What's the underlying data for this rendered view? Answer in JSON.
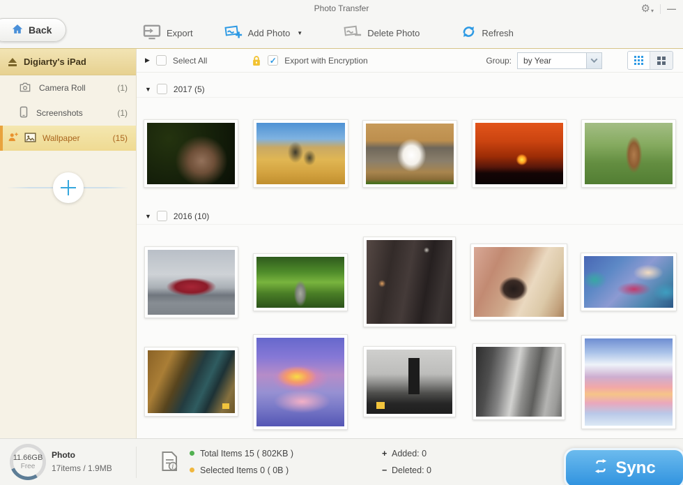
{
  "titlebar": {
    "title": "Photo Transfer"
  },
  "icons": {
    "gear": "⚙",
    "caret_down": "▾",
    "minimize": "—",
    "tri_right": "▶",
    "tri_down": "▼",
    "check": "✓"
  },
  "toolbar": {
    "back_label": "Back",
    "export_label": "Export",
    "add_photo_label": "Add Photo",
    "delete_photo_label": "Delete Photo",
    "refresh_label": "Refresh"
  },
  "sidebar": {
    "device_name": "Digiarty's iPad",
    "items": [
      {
        "label": "Camera Roll",
        "count": "(1)"
      },
      {
        "label": "Screenshots",
        "count": "(1)"
      },
      {
        "label": "Wallpaper",
        "count": "(15)"
      }
    ]
  },
  "filterbar": {
    "select_all": "Select All",
    "encryption": "Export with Encryption",
    "group_label": "Group:",
    "group_value": "by Year"
  },
  "groups": [
    {
      "title": "2017 (5)",
      "photos": [
        {
          "name": "squirrel-shouting",
          "style": "width:126px;height:88px;background:radial-gradient(ellipse 52px 50px at 62% 62%,#93715a 0%,#6e4f38 35%,rgba(20,26,12,0) 72%),radial-gradient(circle at 25% 25%,#24330f 0%,#15200a 55%,#0a0f06 100%)"
        },
        {
          "name": "zebras-in-grass",
          "style": "width:127px;height:88px;background:radial-gradient(ellipse 16px 22px at 44% 48%,#3e3a2c 0%,rgba(62,58,44,0) 70%),radial-gradient(ellipse 13px 16px at 60% 57%,#4a452f 0%,rgba(74,69,47,0) 70%),linear-gradient(180deg,#4e92d4 0%,#7fb2e0 26%,#c9a964 40%,#e0b653 60%,#d3a23f 82%,#c08f2f 100%)"
        },
        {
          "name": "white-cat-shelf",
          "style": "width:126px;height:87px;background:radial-gradient(ellipse 30px 34px at 52% 52%,#ffffff 0%,#f4f1ea 40%,rgba(244,241,234,0) 70%),linear-gradient(180deg,#c79a5a 0%,#bd8f4e 28%,#6f675a 40%,#8a7f6c 62%,#a8854e 80%,#8a6c38 92%,#49701f 98%)"
        },
        {
          "name": "sunset-windmill",
          "style": "width:126px;height:88px;background:radial-gradient(circle 11px at 53% 60%,#ffe94a 0%,#ff9a20 45%,rgba(255,154,32,0) 75%),linear-gradient(180deg,#e2541a 0%,#cb4410 30%,#9c2c06 55%,#58170a 72%,#140505 82%,#0b0304 100%)"
        },
        {
          "name": "squirrel-telescope",
          "style": "width:126px;height:88px;background:radial-gradient(ellipse 15px 34px at 56% 52%,#b07b4c 0%,#8f5e33 50%,rgba(143,94,51,0) 78%),linear-gradient(180deg,#a3bd85 0%,#86ab60 35%,#648e41 65%,#527e33 100%)"
        }
      ]
    },
    {
      "title": "2016 (10)",
      "photos": [
        {
          "name": "red-convertible-car",
          "style": "width:125px;height:93px;background:radial-gradient(ellipse 46px 17px at 50% 57%,#a82536 0%,#8c1b29 50%,rgba(140,27,41,0) 78%),linear-gradient(180deg,#b9bfc7 0%,#ced2d6 38%,#aab0b6 58%,#70767e 70%,#878d93 82%,#7e848a 100%)"
        },
        {
          "name": "green-tree-tunnel",
          "style": "width:126px;height:73px;background:radial-gradient(ellipse 13px 26px at 50% 72%,#a8aca0 0%,#7c8278 45%,rgba(124,130,120,0) 72%),linear-gradient(180deg,#2e5a1d 0%,#4f8c2a 30%,#79b43e 50%,#4a7e26 72%,#2c531a 100%)"
        },
        {
          "name": "dark-brick-street",
          "style": "width:123px;height:120px;background:radial-gradient(circle 7px at 18% 52%,#e0a060 0%,rgba(224,160,96,0) 75%),radial-gradient(circle 6px at 70% 12%,#c8c4bc 0%,rgba(200,196,188,0) 70%),linear-gradient(100deg,#554844 0%,#332b29 28%,#453b39 48%,#262020 68%,#3b3433 85%,#2d2726 100%)"
        },
        {
          "name": "old-piano-room",
          "style": "width:129px;height:100px;background:radial-gradient(ellipse 28px 24px at 44% 60%,#241c1a 0%,#3c2c26 50%,rgba(60,44,38,0) 74%),linear-gradient(115deg,#d8a896 0%,#c28a72 25%,#cfa98c 48%,#ead9c0 62%,#dcc9a8 78%,#c2a17c 92%,#a8835c 100%)"
        },
        {
          "name": "rain-window-bokeh",
          "style": "width:128px;height:74px;background:radial-gradient(ellipse 30px 16px at 72% 32%,#f2dcc2 0%,rgba(242,220,194,0) 72%),radial-gradient(ellipse 34px 14px at 56% 64%,#c33a6c 0%,rgba(195,58,108,0) 72%),radial-gradient(ellipse 24px 18px at 12% 46%,#38a8a4 0%,rgba(56,168,164,0) 72%),radial-gradient(ellipse 26px 18px at 92% 70%,#3e9ec0 0%,rgba(62,158,192,0) 72%),linear-gradient(135deg,#4866b4 0%,#5d89c6 30%,#8c9ad2 52%,#4a86ae 78%,#2c5886 100%)"
        },
        {
          "name": "canyon-river-aerial",
          "style": "width:125px;height:90px;background:linear-gradient(#f2c43c,#f2c43c) 93% 93%/10px 8px no-repeat,linear-gradient(115deg,#8a6226 0%,#aa7e36 22%,#57441e 38%,#233c40 52%,#2f5c60 64%,#1d3236 74%,#86713f 88%,#6b5527 100%)"
        },
        {
          "name": "watercolor-sunset-painting",
          "style": "width:126px;height:127px;background:radial-gradient(ellipse 38px 20px at 46% 44%,#f8dc44 0%,#f59a6a 40%,rgba(245,154,106,0) 75%),radial-gradient(ellipse 52px 26px at 50% 46%,#ef7fa6 0%,rgba(239,127,166,0) 78%),radial-gradient(ellipse 54px 22px at 52% 72%,#f3b0c6 0%,rgba(243,176,198,0) 75%),linear-gradient(180deg,#6668cc 0%,#8678d6 22%,#b68cc8 42%,#9690d2 62%,#7a7ac8 78%,#5456b4 100%)"
        },
        {
          "name": "bw-city-monolith",
          "style": "width:123px;height:92px;background:linear-gradient(#1c1c1c,#1c1c1c) 56% 30%/16px 52px no-repeat,linear-gradient(#f2c43c,#f2c43c) 12% 92%/12px 10px no-repeat,linear-gradient(180deg,#cfcfcd 0%,#bdbdbb 38%,#8d8d8b 52%,#4e4e4c 68%,#262626 84%,#1e1e1e 100%)"
        },
        {
          "name": "bw-arched-street",
          "style": "width:123px;height:100px;background:linear-gradient(100deg,#2e2e2e 0%,#4e4e4e 18%,#848484 32%,#d2d2d0 46%,#8e8e8c 56%,#5e5e5c 68%,#b4b4b2 82%,#9a9a98 92%,#6e6e6c 100%)"
        },
        {
          "name": "winter-watercolor",
          "style": "width:126px;height:125px;background:linear-gradient(180deg,#6e8ed2 0%,#a9c2e8 16%,#eef3f9 30%,#cdaed0 44%,#f2a8a8 56%,#f6c488 64%,#eaa8bc 74%,#b9c8e8 86%,#dce9f5 100%)"
        }
      ]
    }
  ],
  "statusbar": {
    "free_value": "11.66GB",
    "free_label": "Free",
    "media_type": "Photo",
    "media_summary": "17items / 1.9MB",
    "total_items": "Total Items 15 ( 802KB )",
    "selected_items": "Selected Items 0 ( 0B )",
    "added_sign": "+",
    "added_text": "Added:  0",
    "deleted_sign": "−",
    "deleted_text": "Deleted:  0",
    "sync_label": "Sync"
  },
  "colors": {
    "accent_blue": "#2e9ae4",
    "sidebar_highlight": "#efda92",
    "selected_text": "#a9641c",
    "gold_separator": "#d6c488",
    "sync_top": "#6cbbee",
    "sync_bottom": "#2f92df",
    "bullet_green": "#52b151",
    "bullet_yellow": "#f0b73e",
    "lock_gold": "#f2c230"
  }
}
